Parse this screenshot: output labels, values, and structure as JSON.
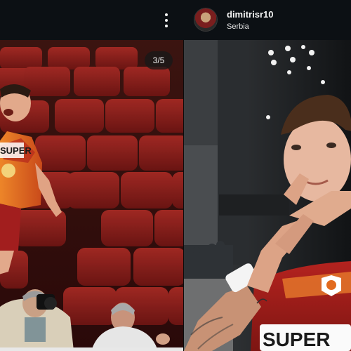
{
  "post": {
    "username": "dimitrisr10",
    "location": "Serbia",
    "more_options_icon": "ellipsis-vertical-icon",
    "avatar_icon": "profile-avatar"
  },
  "carousel": {
    "counter": "3/5",
    "current": 3,
    "total": 5
  },
  "slides": [
    {
      "jersey_text": "SUPER"
    },
    {
      "jersey_text": "SUPER"
    }
  ],
  "colors": {
    "topbar_bg": "#0c1014",
    "stadium_seat_red": "#8a1f1f",
    "jersey_orange": "#e26a1e",
    "jersey_red": "#9b1c1c"
  }
}
